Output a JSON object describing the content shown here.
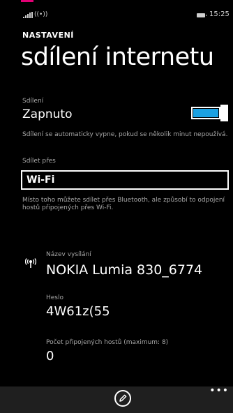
{
  "status": {
    "time": "15:25"
  },
  "header": {
    "app_title": "NASTAVENÍ",
    "page_title": "sdílení internetu"
  },
  "sharing": {
    "label": "Sdílení",
    "value": "Zapnuto",
    "toggle_on": true,
    "description": "Sdílení se automaticky vypne, pokud se několik minut nepoužívá."
  },
  "share_over": {
    "label": "Sdílet přes",
    "selected": "Wi-Fi",
    "description": "Místo toho můžete sdílet přes Bluetooth, ale způsobí to odpojení hostů připojených přes Wi-Fi."
  },
  "network": {
    "name_label": "Název vysílání",
    "name": "NOKIA Lumia 830_6774",
    "password_label": "Heslo",
    "password": "4W61z(55",
    "hosts_label": "Počet připojených hostů (maximum: 8)",
    "hosts": "0"
  },
  "colors": {
    "accent": "#1ba1e2",
    "brand": "#e20074",
    "background": "#000000",
    "appbar": "#1f1f1f"
  },
  "icons": {
    "edit": "edit-icon",
    "more": "more-icon",
    "hotspot": "wifi-hotspot-icon"
  }
}
